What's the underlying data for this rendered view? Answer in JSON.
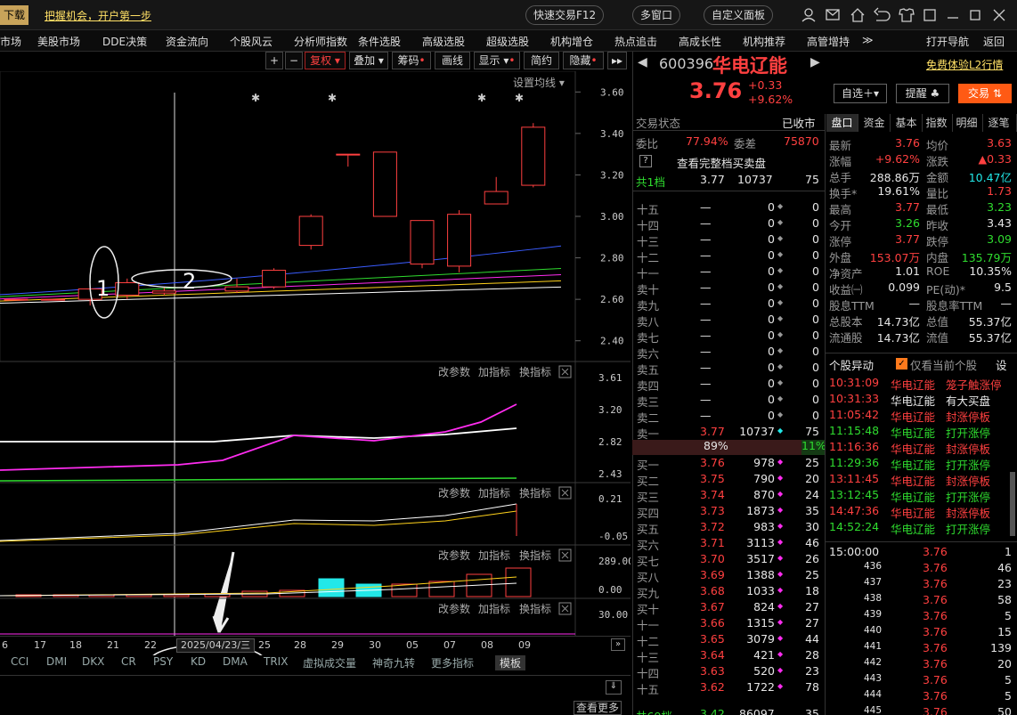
{
  "topbar": {
    "download": "下载",
    "promo": "把握机会，开户第一步",
    "quick_trade": "快速交易F12",
    "multi_window": "多窗口",
    "custom_panel": "自定义面板"
  },
  "menu": [
    "市场",
    "美股市场",
    "DDE决策",
    "资金流向",
    "个股风云",
    "分析师指数",
    "条件选股",
    "高级选股",
    "超级选股",
    "机构增仓",
    "热点追击",
    "高成长性",
    "机构推荐",
    "高管增持",
    "打开导航",
    "返回"
  ],
  "toolbar": {
    "plus": "+",
    "minus": "−",
    "fuquan": "复权",
    "overlay": "叠加",
    "chips": "筹码",
    "draw": "画线",
    "display": "显示",
    "simple": "简约",
    "hide": "隐藏"
  },
  "chart_main": {
    "ma_setting": "设置均线",
    "yaxis": [
      "3.60",
      "3.40",
      "3.20",
      "3.00",
      "2.80",
      "2.60",
      "2.40"
    ],
    "hi_label": "3.77",
    "annot1": "1",
    "annot2": "2"
  },
  "chart_data": {
    "type": "candlestick",
    "dates": [
      "16",
      "17",
      "18",
      "21",
      "22",
      "23",
      "24",
      "25",
      "28",
      "29",
      "30",
      "05",
      "07",
      "08",
      "09"
    ],
    "open": [
      2.6,
      2.6,
      2.6,
      2.62,
      2.63,
      2.64,
      2.66,
      2.86,
      3.3,
      3.0,
      2.77,
      2.76,
      3.06,
      3.15,
      3.26
    ],
    "close": [
      2.6,
      2.6,
      2.65,
      2.68,
      2.64,
      2.66,
      2.74,
      3.0,
      3.3,
      3.31,
      2.98,
      3.01,
      3.12,
      3.43,
      3.76
    ],
    "high": [
      2.6,
      2.6,
      2.65,
      2.7,
      2.66,
      2.7,
      2.75,
      3.01,
      3.3,
      3.31,
      2.98,
      3.03,
      3.19,
      3.45,
      3.77
    ],
    "low": [
      2.6,
      2.6,
      2.57,
      2.6,
      2.62,
      2.63,
      2.65,
      2.84,
      3.24,
      3.0,
      2.75,
      2.73,
      3.06,
      3.14,
      3.26
    ],
    "ylim": [
      2.3,
      3.7
    ]
  },
  "ind1": {
    "params": "改参数",
    "add": "加指标",
    "swap": "换指标",
    "yaxis": [
      "3.61",
      "3.20",
      "2.82",
      "2.43"
    ]
  },
  "ind2": {
    "params": "改参数",
    "add": "加指标",
    "swap": "换指标",
    "yaxis": [
      "0.21",
      "-0.05"
    ]
  },
  "ind3": {
    "params": "改参数",
    "add": "加指标",
    "swap": "换指标",
    "yaxis": [
      "289.00",
      "0.00"
    ]
  },
  "ind4": {
    "params": "改参数",
    "add": "加指标",
    "swap": "换指标",
    "yaxis": [
      "30.00"
    ]
  },
  "xaxis": {
    "labels": [
      "6",
      "17",
      "18",
      "21",
      "22",
      "25",
      "28",
      "29",
      "30",
      "05",
      "07",
      "08",
      "09"
    ],
    "cursor_date": "2025/04/23/三"
  },
  "bottom_tabs": [
    "CCI",
    "DMI",
    "DKX",
    "CR",
    "PSY",
    "KD",
    "DMA",
    "TRIX",
    "虚拟成交量",
    "神奇九转",
    "更多指标",
    "模板"
  ],
  "see_more": "查看更多",
  "stock": {
    "code": "600396",
    "name": "华电辽能",
    "l2": "免费体验L2行情",
    "price": "3.76",
    "chg": "+0.33",
    "pct": "+9.62%",
    "fav": "自选",
    "remind": "提醒",
    "trade": "交易"
  },
  "status": {
    "label": "交易状态",
    "value": "已收市",
    "wb": "委比",
    "wb_v": "77.94%",
    "wc": "委差",
    "wc_v": "75870",
    "full": "查看完整档买卖盘",
    "total": "共1档",
    "total_p": "3.77",
    "total_v": "10737",
    "total_n": "75"
  },
  "book_sell": [
    [
      "十五",
      "—",
      "0",
      "0"
    ],
    [
      "十四",
      "—",
      "0",
      "0"
    ],
    [
      "十三",
      "—",
      "0",
      "0"
    ],
    [
      "十二",
      "—",
      "0",
      "0"
    ],
    [
      "十一",
      "—",
      "0",
      "0"
    ],
    [
      "卖十",
      "—",
      "0",
      "0"
    ],
    [
      "卖九",
      "—",
      "0",
      "0"
    ],
    [
      "卖八",
      "—",
      "0",
      "0"
    ],
    [
      "卖七",
      "—",
      "0",
      "0"
    ],
    [
      "卖六",
      "—",
      "0",
      "0"
    ],
    [
      "卖五",
      "—",
      "0",
      "0"
    ],
    [
      "卖四",
      "—",
      "0",
      "0"
    ],
    [
      "卖三",
      "—",
      "0",
      "0"
    ],
    [
      "卖二",
      "—",
      "0",
      "0"
    ],
    [
      "卖一",
      "3.77",
      "10737",
      "75"
    ]
  ],
  "ratio": {
    "left": "89%",
    "right": "11%"
  },
  "book_buy": [
    [
      "买一",
      "3.76",
      "978",
      "25"
    ],
    [
      "买二",
      "3.75",
      "790",
      "20"
    ],
    [
      "买三",
      "3.74",
      "870",
      "24"
    ],
    [
      "买四",
      "3.73",
      "1873",
      "35"
    ],
    [
      "买五",
      "3.72",
      "983",
      "30"
    ],
    [
      "买六",
      "3.71",
      "3113",
      "46"
    ],
    [
      "买七",
      "3.70",
      "3517",
      "26"
    ],
    [
      "买八",
      "3.69",
      "1388",
      "25"
    ],
    [
      "买九",
      "3.68",
      "1033",
      "18"
    ],
    [
      "买十",
      "3.67",
      "824",
      "27"
    ],
    [
      "十一",
      "3.66",
      "1315",
      "27"
    ],
    [
      "十二",
      "3.65",
      "3079",
      "44"
    ],
    [
      "十三",
      "3.64",
      "421",
      "28"
    ],
    [
      "十四",
      "3.63",
      "520",
      "23"
    ],
    [
      "十五",
      "3.62",
      "1722",
      "78"
    ]
  ],
  "book_foot": {
    "label": "共69档",
    "p": "3.42",
    "v": "86097",
    "n": "35"
  },
  "tabs": [
    "盘口",
    "资金",
    "基本",
    "指数",
    "明细",
    "逐笔"
  ],
  "quote": [
    [
      "最新",
      "3.76",
      "均价",
      "3.63"
    ],
    [
      "涨幅",
      "+9.62%",
      "涨跌",
      "▲0.33"
    ],
    [
      "总手",
      "288.86万",
      "金额",
      "10.47亿"
    ],
    [
      "换手*",
      "19.61%",
      "量比",
      "1.73"
    ],
    [
      "最高",
      "3.77",
      "最低",
      "3.23"
    ],
    [
      "今开",
      "3.26",
      "昨收",
      "3.43"
    ],
    [
      "涨停",
      "3.77",
      "跌停",
      "3.09"
    ],
    [
      "外盘",
      "153.07万",
      "内盘",
      "135.79万"
    ],
    [
      "净资产",
      "1.01",
      "ROE",
      "10.35%"
    ],
    [
      "收益㈠",
      "0.099",
      "PE(动)*",
      "9.5"
    ],
    [
      "股息TTM",
      "—",
      "股息率TTM",
      "—"
    ],
    [
      "总股本",
      "14.73亿",
      "总值",
      "55.37亿"
    ],
    [
      "流通股",
      "14.73亿",
      "流值",
      "55.37亿"
    ]
  ],
  "events": {
    "title": "个股异动",
    "only": "仅看当前个股",
    "set": "设",
    "rows": [
      [
        "10:31:09",
        "华电辽能",
        "笼子触涨停"
      ],
      [
        "10:31:33",
        "华电辽能",
        "有大买盘"
      ],
      [
        "11:05:42",
        "华电辽能",
        "封涨停板"
      ],
      [
        "11:15:48",
        "华电辽能",
        "打开涨停"
      ],
      [
        "11:16:36",
        "华电辽能",
        "封涨停板"
      ],
      [
        "11:29:36",
        "华电辽能",
        "打开涨停"
      ],
      [
        "13:11:45",
        "华电辽能",
        "封涨停板"
      ],
      [
        "13:12:45",
        "华电辽能",
        "打开涨停"
      ],
      [
        "14:47:36",
        "华电辽能",
        "封涨停板"
      ],
      [
        "14:52:24",
        "华电辽能",
        "打开涨停"
      ]
    ]
  },
  "ticks": [
    [
      "15:00:00",
      "3.76",
      "1"
    ],
    [
      "436",
      "3.76",
      "46"
    ],
    [
      "437",
      "3.76",
      "23"
    ],
    [
      "438",
      "3.76",
      "58"
    ],
    [
      "439",
      "3.76",
      "5"
    ],
    [
      "440",
      "3.76",
      "15"
    ],
    [
      "441",
      "3.76",
      "139"
    ],
    [
      "442",
      "3.76",
      "20"
    ],
    [
      "443",
      "3.76",
      "5"
    ],
    [
      "444",
      "3.76",
      "5"
    ],
    [
      "445",
      "3.76",
      "50"
    ]
  ]
}
